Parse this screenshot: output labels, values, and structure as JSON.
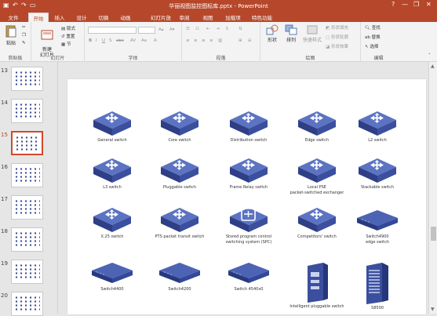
{
  "window": {
    "title": "华丽视图监控图标库.pptx - PowerPoint",
    "controls": [
      "?",
      "—",
      "❐",
      "✕"
    ]
  },
  "quick_access": [
    "save-icon",
    "undo-icon",
    "redo-icon",
    "slideshow-icon"
  ],
  "tabs": [
    {
      "label": "文件",
      "active": false,
      "file": true
    },
    {
      "label": "开始",
      "active": true
    },
    {
      "label": "插入",
      "active": false
    },
    {
      "label": "设计",
      "active": false
    },
    {
      "label": "切换",
      "active": false
    },
    {
      "label": "动画",
      "active": false
    },
    {
      "label": "幻灯片放映",
      "active": false
    },
    {
      "label": "审阅",
      "active": false
    },
    {
      "label": "视图",
      "active": false
    },
    {
      "label": "加载项",
      "active": false
    },
    {
      "label": "特色功能",
      "active": false
    }
  ],
  "ribbon": {
    "clipboard": {
      "label": "剪贴板",
      "paste": "粘贴"
    },
    "slides": {
      "label": "幻灯片",
      "new_slide": "新建\n幻灯片",
      "layout": "版式",
      "reset": "重置",
      "section": "节"
    },
    "font": {
      "label": "字体",
      "font_value": "",
      "size_value": ""
    },
    "paragraph": {
      "label": "段落"
    },
    "drawing": {
      "label": "绘图",
      "shapes": "形状",
      "arrange": "排列",
      "quick_styles": "快速样式",
      "fill": "形状填充",
      "outline": "形状轮廓",
      "effects": "形状效果"
    },
    "editing": {
      "label": "编辑",
      "find": "查找",
      "replace": "替换",
      "select": "选择"
    }
  },
  "thumbnails": [
    {
      "number": "13",
      "selected": false
    },
    {
      "number": "14",
      "selected": false
    },
    {
      "number": "15",
      "selected": true
    },
    {
      "number": "16",
      "selected": false
    },
    {
      "number": "17",
      "selected": false
    },
    {
      "number": "18",
      "selected": false
    },
    {
      "number": "19",
      "selected": false
    },
    {
      "number": "20",
      "selected": false
    }
  ],
  "devices": [
    {
      "label": "General switch",
      "kind": "switch",
      "icon": "general-switch-icon"
    },
    {
      "label": "Core switch",
      "kind": "switch",
      "icon": "core-switch-icon"
    },
    {
      "label": "Distribution switch",
      "kind": "switch",
      "icon": "distribution-switch-icon"
    },
    {
      "label": "Edge switch",
      "kind": "switch",
      "icon": "edge-switch-icon"
    },
    {
      "label": "L2 switch",
      "kind": "switch",
      "icon": "l2-switch-icon"
    },
    {
      "label": "L3 switch",
      "kind": "switch",
      "icon": "l3-switch-icon"
    },
    {
      "label": "Pluggable switch",
      "kind": "switch",
      "icon": "pluggable-switch-icon"
    },
    {
      "label": "Frame Relay switch",
      "kind": "switch",
      "icon": "frame-relay-switch-icon"
    },
    {
      "label": "Local PSE\npacket-switched exchanger",
      "kind": "switch",
      "icon": "local-pse-icon"
    },
    {
      "label": "Stackable switch",
      "kind": "switch",
      "icon": "stackable-switch-icon"
    },
    {
      "label": "X.25 switch",
      "kind": "switch",
      "icon": "x25-switch-icon"
    },
    {
      "label": "PTS packet transit switch",
      "kind": "switch",
      "icon": "pts-switch-icon"
    },
    {
      "label": "Stored program control\nswitching system (SPC)",
      "kind": "spc",
      "icon": "spc-switch-icon"
    },
    {
      "label": "Competitors' switch",
      "kind": "switch",
      "icon": "competitors-switch-icon"
    },
    {
      "label": "Switch4900\nedge switch",
      "kind": "flat",
      "icon": "switch4900-icon"
    },
    {
      "label": "Switch4400",
      "kind": "flat",
      "icon": "switch4400-icon"
    },
    {
      "label": "Switch4200",
      "kind": "flat",
      "icon": "switch4200-icon"
    },
    {
      "label": "Switch 4540x0",
      "kind": "flat",
      "icon": "switch4540-icon"
    },
    {
      "label": "Intelligent pluggable switch",
      "kind": "tower",
      "icon": "intelligent-pluggable-switch-icon"
    },
    {
      "label": "S8500",
      "kind": "rack",
      "icon": "s8500-icon"
    }
  ]
}
